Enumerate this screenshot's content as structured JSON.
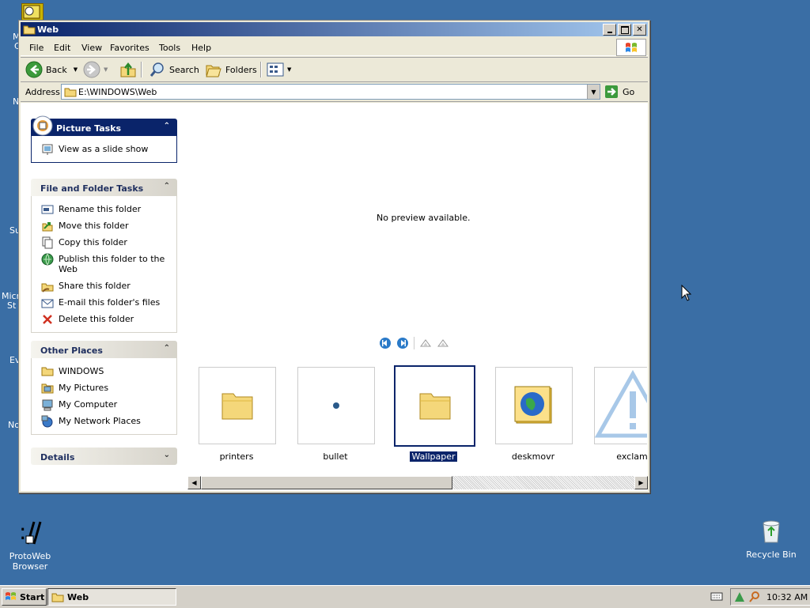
{
  "desktop": {
    "protoweb": "ProtoWeb\nBrowser",
    "protoweb_line1": "ProtoWeb",
    "protoweb_line2": "Browser",
    "recycle_bin": "Recycle Bin",
    "cut_labels": [
      "M",
      "C",
      "N",
      "Su",
      "Micro",
      "St",
      "Ev",
      "No"
    ]
  },
  "window": {
    "title": "Web",
    "menu": [
      "File",
      "Edit",
      "View",
      "Favorites",
      "Tools",
      "Help"
    ],
    "toolbar": {
      "back": "Back",
      "search": "Search",
      "folders": "Folders"
    },
    "address": {
      "label": "Address",
      "value": "E:\\WINDOWS\\Web",
      "go": "Go"
    }
  },
  "taskpane": {
    "picture_tasks": {
      "title": "Picture Tasks",
      "items": [
        "View as a slide show"
      ]
    },
    "file_folder_tasks": {
      "title": "File and Folder Tasks",
      "items": [
        "Rename this folder",
        "Move this folder",
        "Copy this folder",
        "Publish this folder to the Web",
        "Share this folder",
        "E-mail this folder's files",
        "Delete this folder"
      ]
    },
    "other_places": {
      "title": "Other Places",
      "items": [
        "WINDOWS",
        "My Pictures",
        "My Computer",
        "My Network Places"
      ]
    },
    "details": {
      "title": "Details"
    }
  },
  "preview": {
    "message": "No preview available."
  },
  "thumbnails": [
    {
      "label": "printers",
      "icon": "folder-icon"
    },
    {
      "label": "bullet",
      "icon": "bullet-dot"
    },
    {
      "label": "Wallpaper",
      "icon": "folder-icon",
      "selected": true
    },
    {
      "label": "deskmovr",
      "icon": "globe-icon"
    },
    {
      "label": "exclam",
      "icon": "warning-icon"
    }
  ],
  "taskbar": {
    "start": "Start",
    "window_button": "Web",
    "clock": "10:32 AM"
  },
  "colors": {
    "desktop": "#3a6ea5",
    "titlebar_start": "#0a246a",
    "selection": "#0a246a"
  }
}
